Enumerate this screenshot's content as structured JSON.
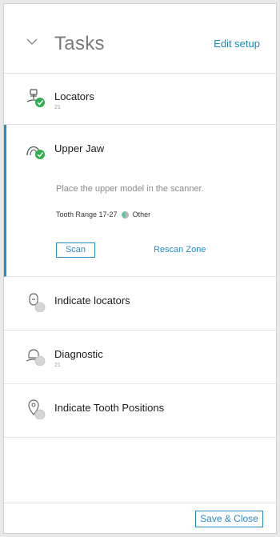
{
  "header": {
    "title": "Tasks",
    "edit_setup": "Edit setup"
  },
  "tasks": [
    {
      "name": "Locators",
      "sub": "21",
      "icon": "locator-icon",
      "status": "done"
    },
    {
      "name": "Upper Jaw",
      "icon": "upper-jaw-icon",
      "status": "done",
      "description": "Place the upper model in the scanner.",
      "tooth_range": "Tooth Range 17-27",
      "material": "Other",
      "scan_label": "Scan",
      "rescan_label": "Rescan Zone"
    },
    {
      "name": "Indicate locators",
      "icon": "indicate-locators-icon",
      "status": "pending"
    },
    {
      "name": "Diagnostic",
      "sub": "21",
      "icon": "diagnostic-icon",
      "status": "pending"
    },
    {
      "name": "Indicate Tooth Positions",
      "icon": "tooth-position-icon",
      "status": "pending"
    }
  ],
  "footer": {
    "save_close": "Save & Close"
  },
  "colors": {
    "accent": "#2a8cc4",
    "done": "#2fae4e",
    "pending": "#d6d6d6"
  }
}
